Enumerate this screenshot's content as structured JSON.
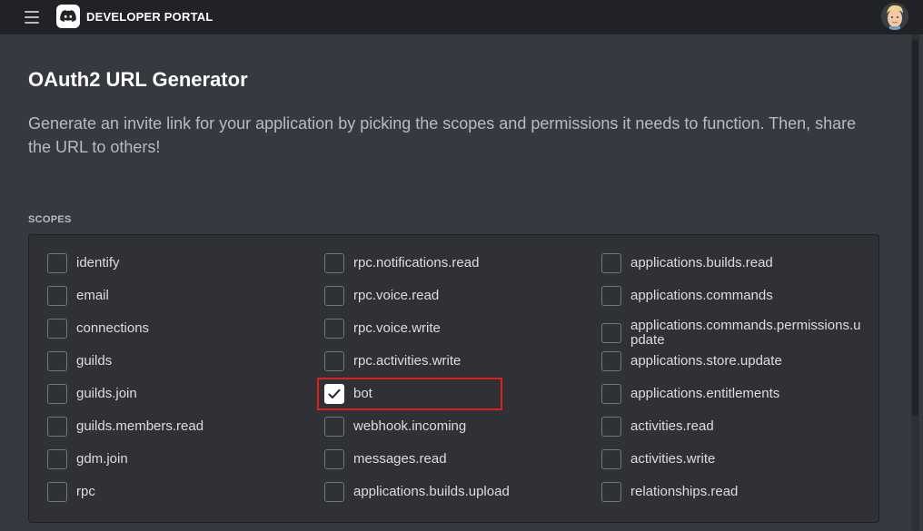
{
  "header": {
    "brand": "DEVELOPER PORTAL"
  },
  "page": {
    "title": "OAuth2 URL Generator",
    "description": "Generate an invite link for your application by picking the scopes and permissions it needs to function. Then, share the URL to others!"
  },
  "scopes": {
    "section_label": "SCOPES",
    "items": [
      {
        "label": "identify",
        "checked": false
      },
      {
        "label": "email",
        "checked": false
      },
      {
        "label": "connections",
        "checked": false
      },
      {
        "label": "guilds",
        "checked": false
      },
      {
        "label": "guilds.join",
        "checked": false
      },
      {
        "label": "guilds.members.read",
        "checked": false
      },
      {
        "label": "gdm.join",
        "checked": false
      },
      {
        "label": "rpc",
        "checked": false
      },
      {
        "label": "rpc.notifications.read",
        "checked": false
      },
      {
        "label": "rpc.voice.read",
        "checked": false
      },
      {
        "label": "rpc.voice.write",
        "checked": false
      },
      {
        "label": "rpc.activities.write",
        "checked": false
      },
      {
        "label": "bot",
        "checked": true
      },
      {
        "label": "webhook.incoming",
        "checked": false
      },
      {
        "label": "messages.read",
        "checked": false
      },
      {
        "label": "applications.builds.upload",
        "checked": false
      },
      {
        "label": "applications.builds.read",
        "checked": false
      },
      {
        "label": "applications.commands",
        "checked": false
      },
      {
        "label": "applications.commands.permissions.update",
        "checked": false
      },
      {
        "label": "applications.store.update",
        "checked": false
      },
      {
        "label": "applications.entitlements",
        "checked": false
      },
      {
        "label": "activities.read",
        "checked": false
      },
      {
        "label": "activities.write",
        "checked": false
      },
      {
        "label": "relationships.read",
        "checked": false
      }
    ]
  },
  "icons": {
    "menu": "hamburger-menu-icon",
    "logo": "discord-logo-icon",
    "avatar": "user-avatar",
    "check": "checkmark-icon"
  },
  "colors": {
    "background": "#36393f",
    "topbar": "#202225",
    "panel": "#2f3136",
    "highlight": "#e01e1e"
  }
}
